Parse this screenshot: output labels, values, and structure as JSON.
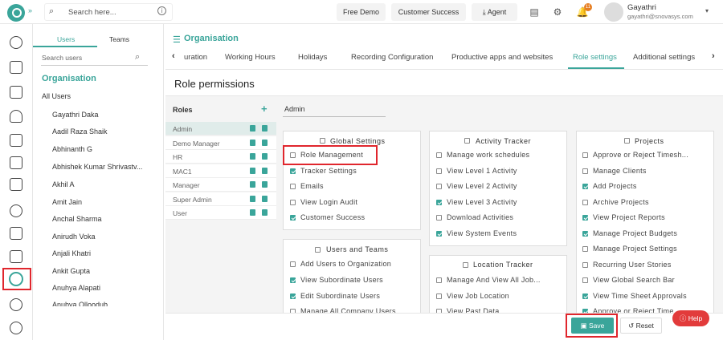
{
  "header": {
    "search_placeholder": "Search here...",
    "free_demo": "Free Demo",
    "customer_success": "Customer Success",
    "agent": "Agent",
    "notif_count": "11",
    "user_name": "Gayathri",
    "user_email": "gayathri@snovasys.com"
  },
  "side": {
    "tabs": [
      "Users",
      "Teams"
    ],
    "search_placeholder": "Search users",
    "org_label": "Organisation",
    "all_users": "All Users",
    "users": [
      "Gayathri Daka",
      "Aadil Raza Shaik",
      "Abhinanth G",
      "Abhishek Kumar Shrivastv...",
      "Akhil A",
      "Amit Jain",
      "Anchal Sharma",
      "Anirudh Voka",
      "Anjali Khatri",
      "Ankit Gupta",
      "Anuhya Alapati",
      "Anubya Olloodub"
    ]
  },
  "main": {
    "breadcrumb": "Organisation",
    "tabs": [
      "uration",
      "Working Hours",
      "Holidays",
      "Recording Configuration",
      "Productive apps and websites",
      "Role settings",
      "Additional settings"
    ],
    "active_tab": "Role settings",
    "page_title": "Role permissions",
    "roles_header": "Roles",
    "add_symbol": "+",
    "roles": [
      "Admin",
      "Demo Manager",
      "HR",
      "MAC1",
      "Manager",
      "Super Admin",
      "User"
    ],
    "role_name_value": "Admin",
    "save_label": "Save",
    "reset_label": "Reset",
    "help_label": "Help"
  },
  "panels": {
    "global": {
      "title": "Global Settings",
      "items": [
        {
          "label": "Role Management",
          "checked": false
        },
        {
          "label": "Tracker Settings",
          "checked": true
        },
        {
          "label": "Emails",
          "checked": false
        },
        {
          "label": "View Login Audit",
          "checked": false
        },
        {
          "label": "Customer Success",
          "checked": true
        }
      ]
    },
    "users": {
      "title": "Users and Teams",
      "items": [
        {
          "label": "Add Users to Organization",
          "checked": false
        },
        {
          "label": "View Subordinate Users",
          "checked": true
        },
        {
          "label": "Edit Subordinate Users",
          "checked": true
        },
        {
          "label": "Manage All Company Users",
          "checked": false
        }
      ]
    },
    "activity": {
      "title": "Activity Tracker",
      "items": [
        {
          "label": "Manage work schedules",
          "checked": false
        },
        {
          "label": "View Level 1 Activity",
          "checked": false
        },
        {
          "label": "View Level 2 Activity",
          "checked": false
        },
        {
          "label": "View Level 3 Activity",
          "checked": true
        },
        {
          "label": "Download Activities",
          "checked": false
        },
        {
          "label": "View System Events",
          "checked": true
        }
      ]
    },
    "location": {
      "title": "Location Tracker",
      "items": [
        {
          "label": "Manage And View All Job...",
          "checked": false
        },
        {
          "label": "View Job Location",
          "checked": false
        },
        {
          "label": "View Past Data",
          "checked": false
        }
      ]
    },
    "projects": {
      "title": "Projects",
      "items": [
        {
          "label": "Approve or Reject Timesh...",
          "checked": false
        },
        {
          "label": "Manage Clients",
          "checked": false
        },
        {
          "label": "Add Projects",
          "checked": true
        },
        {
          "label": "Archive Projects",
          "checked": false
        },
        {
          "label": "View Project Reports",
          "checked": true
        },
        {
          "label": "Manage Project Budgets",
          "checked": true
        },
        {
          "label": "Manage Project Settings",
          "checked": false
        },
        {
          "label": "Recurring User Stories",
          "checked": false
        },
        {
          "label": "View Global Search Bar",
          "checked": false
        },
        {
          "label": "View Time Sheet Approvals",
          "checked": true
        },
        {
          "label": "Approve or Reject Time...",
          "checked": true
        }
      ]
    }
  },
  "colors": {
    "accent": "#3aa59a",
    "highlight": "#e0262d"
  }
}
